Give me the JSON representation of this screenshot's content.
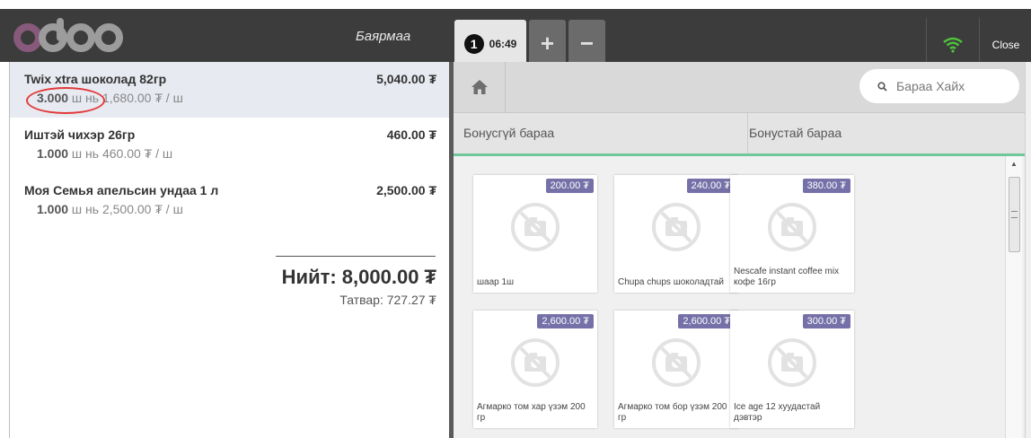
{
  "topbar": {
    "logo_text": "odoo",
    "cashier": "Баярмаа",
    "order_number": "1",
    "order_time": "06:49",
    "add_order_symbol": "+",
    "remove_order_symbol": "−",
    "wifi_color": "#4fc23c",
    "close_label": "Close"
  },
  "order": {
    "lines": [
      {
        "name": "Twix xtra шоколад 82гр",
        "price": "5,040.00 ₮",
        "qty": "3.000",
        "unit_info": " ш нь 1,680.00 ₮ / ш"
      },
      {
        "name": "Иштэй чихэр 26гр",
        "price": "460.00 ₮",
        "qty": "1.000",
        "unit_info": " ш нь 460.00 ₮ / ш"
      },
      {
        "name": "Моя Семья апельсин ундаа 1 л",
        "price": "2,500.00 ₮",
        "qty": "1.000",
        "unit_info": " ш нь 2,500.00 ₮ / ш"
      }
    ],
    "total": "Нийт: 8,000.00 ₮",
    "tax": "Татвар: 727.27 ₮"
  },
  "products_panel": {
    "search_placeholder": "Бараа Хайх",
    "categories": [
      "Бонусгүй бараа",
      "Бонустай бараа"
    ],
    "products": [
      {
        "name": "шаар 1ш",
        "price": "200.00 ₮"
      },
      {
        "name": "Chupa chups шоколадтай",
        "price": "240.00 ₮"
      },
      {
        "name": "Nescafe instant coffee mix кофе 16гр",
        "price": "380.00 ₮"
      },
      {
        "name": "Агмарко том хар үзэм 200 гр",
        "price": "2,600.00 ₮"
      },
      {
        "name": "Агмарко том бор үзэм 200 гр",
        "price": "2,600.00 ₮"
      },
      {
        "name": "Ice age 12 хуудастай дэвтэр",
        "price": "300.00 ₮"
      }
    ]
  },
  "colors": {
    "topbar_bg": "#3c3c3c",
    "logo_purple": "#875a7b",
    "price_badge": "#7571a8",
    "category_underline": "#6ec89b",
    "annotation_circle": "#e23a3a"
  }
}
